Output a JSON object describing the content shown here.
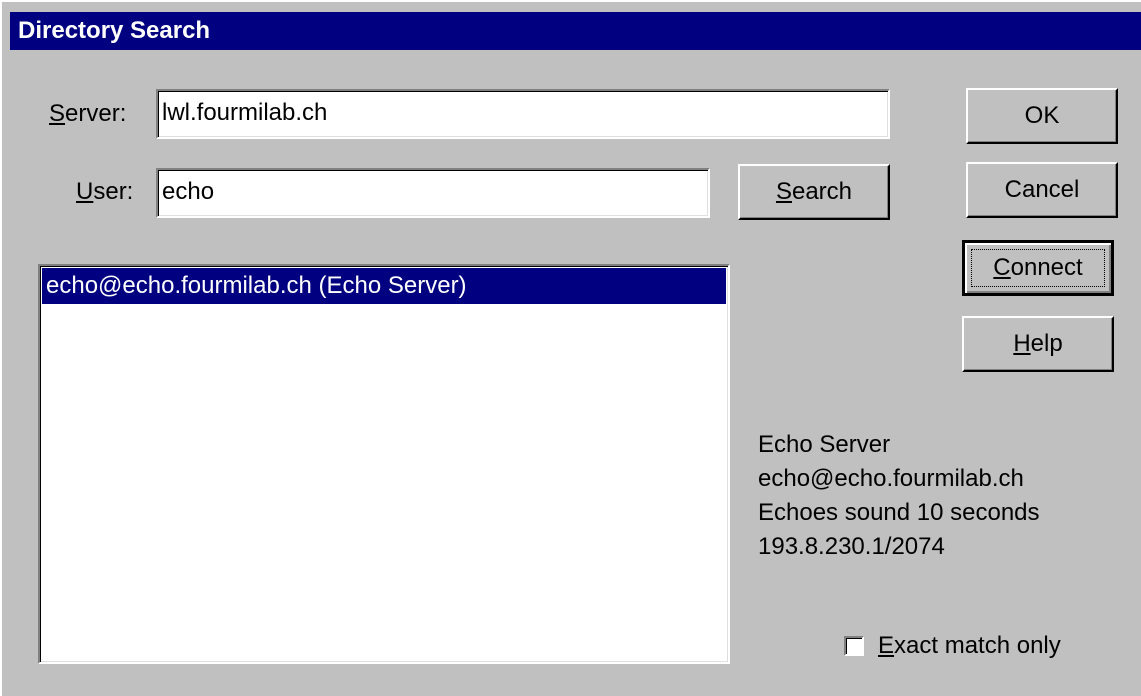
{
  "window": {
    "title": "Directory Search"
  },
  "server": {
    "label_prefix": "",
    "label_accel": "S",
    "label_rest": "erver:",
    "value": "lwl.fourmilab.ch"
  },
  "user": {
    "label_accel": "U",
    "label_rest": "ser:",
    "value": "echo"
  },
  "buttons": {
    "ok": "OK",
    "cancel": "Cancel",
    "connect_accel": "C",
    "connect_rest": "onnect",
    "help_accel": "H",
    "help_rest": "elp",
    "search_accel": "S",
    "search_rest": "earch"
  },
  "results": {
    "items": [
      "echo@echo.fourmilab.ch (Echo Server)"
    ],
    "selected_index": 0
  },
  "details": {
    "name": "Echo Server",
    "address": "echo@echo.fourmilab.ch",
    "description": "Echoes sound 10 seconds",
    "ip_port": "193.8.230.1/2074"
  },
  "exact_match": {
    "accel": "E",
    "rest": "xact match only",
    "checked": false
  },
  "colors": {
    "titlebar": "#000080",
    "face": "#c0c0c0",
    "selection": "#000080"
  }
}
